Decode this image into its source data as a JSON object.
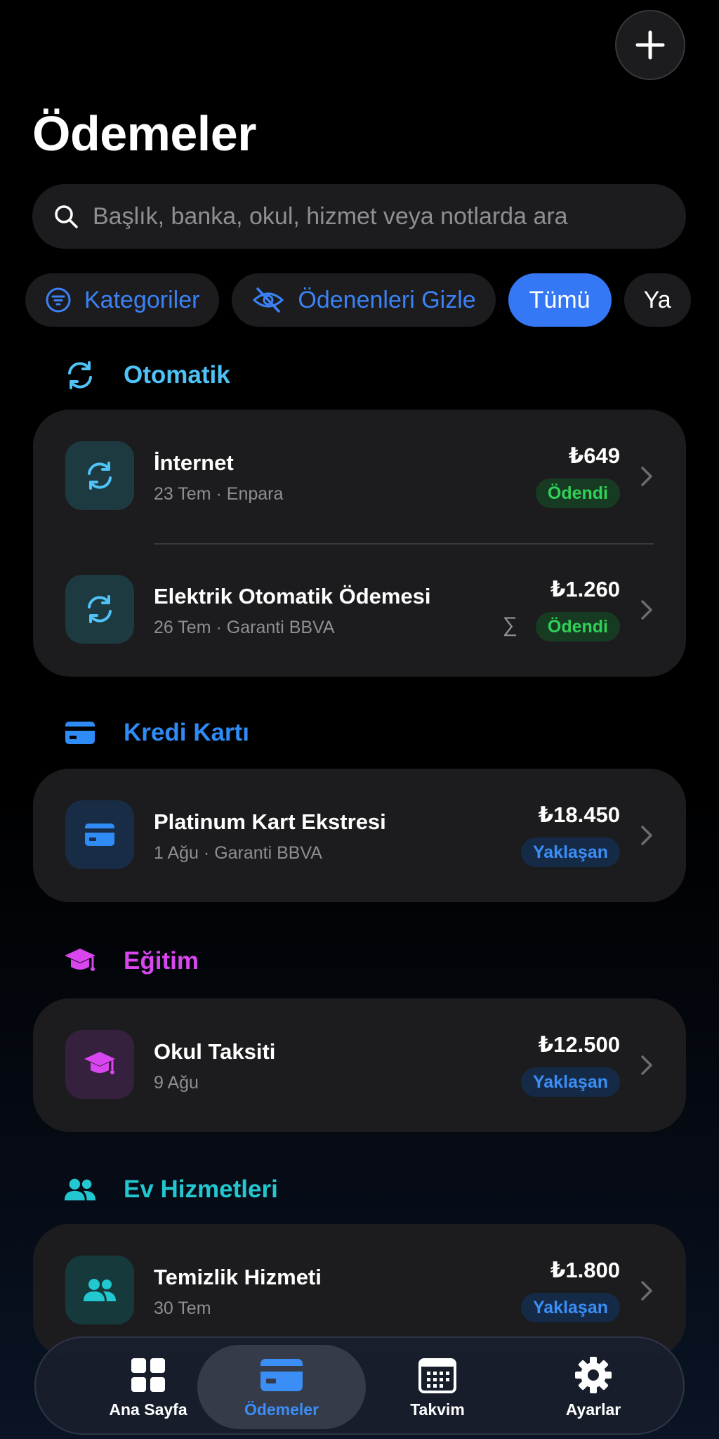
{
  "header": {
    "title": "Ödemeler",
    "add_icon": "plus-icon"
  },
  "search": {
    "placeholder": "Başlık, banka, okul, hizmet veya notlarda ara",
    "value": ""
  },
  "filters": [
    {
      "label": "Kategoriler",
      "icon": "filter-icon"
    },
    {
      "label": "Ödenenleri Gizle",
      "icon": "eye-slash-icon"
    },
    {
      "label": "Tümü",
      "selected": true
    },
    {
      "label": "Ya"
    }
  ],
  "sections": [
    {
      "title": "Otomatik",
      "color": "#4fc3f7",
      "icon": "sync-icon",
      "items": [
        {
          "title": "İnternet",
          "date": "23 Tem",
          "bank": "Enpara",
          "amount": "₺649",
          "status": "Ödendi",
          "status_type": "paid"
        },
        {
          "title": "Elektrik Otomatik Ödemesi",
          "date": "26 Tem",
          "bank": "Garanti BBVA",
          "amount": "₺1.260",
          "status": "Ödendi",
          "status_type": "paid",
          "marker": "∑"
        }
      ]
    },
    {
      "title": "Kredi Kartı",
      "color": "#2f8bf5",
      "icon": "credit-card-icon",
      "items": [
        {
          "title": "Platinum Kart Ekstresi",
          "date": "1 Ağu",
          "bank": "Garanti BBVA",
          "amount": "₺18.450",
          "status": "Yaklaşan",
          "status_type": "upcoming"
        }
      ]
    },
    {
      "title": "Eğitim",
      "color": "#d946ef",
      "icon": "graduation-cap-icon",
      "items": [
        {
          "title": "Okul Taksiti",
          "date": "9 Ağu",
          "amount": "₺12.500",
          "status": "Yaklaşan",
          "status_type": "upcoming"
        }
      ]
    },
    {
      "title": "Ev Hizmetleri",
      "color": "#22c7cf",
      "icon": "people-icon",
      "items": [
        {
          "title": "Temizlik Hizmeti",
          "date": "30 Tem",
          "amount": "₺1.800",
          "status": "Yaklaşan",
          "status_type": "upcoming"
        }
      ]
    }
  ],
  "tabbar": [
    {
      "label": "Ana Sayfa",
      "icon": "grid-icon"
    },
    {
      "label": "Ödemeler",
      "icon": "credit-card-icon",
      "active": true
    },
    {
      "label": "Takvim",
      "icon": "calendar-icon"
    },
    {
      "label": "Ayarlar",
      "icon": "gear-icon"
    }
  ]
}
